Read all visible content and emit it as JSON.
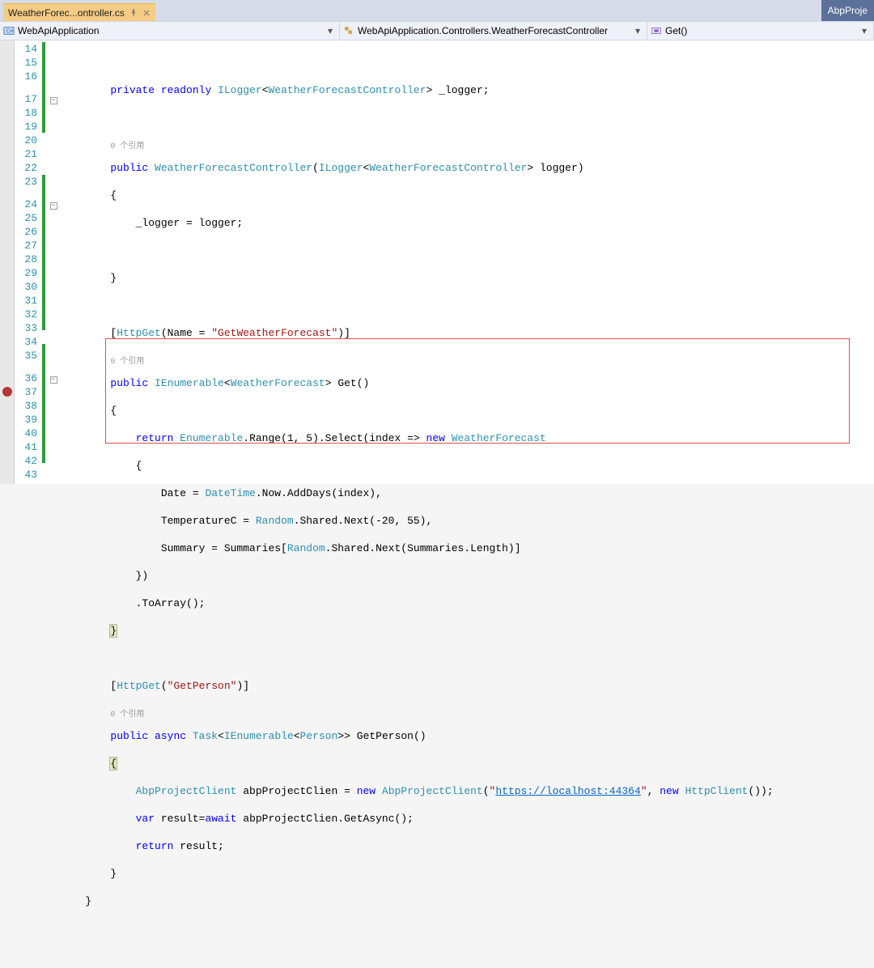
{
  "tab": {
    "title": "WeatherForec...ontroller.cs"
  },
  "rightTab": "AbpProje",
  "nav": {
    "scope1": "WebApiApplication",
    "scope2": "WebApiApplication.Controllers.WeatherForecastController",
    "scope3": "Get()"
  },
  "lines": [
    "14",
    "15",
    "16",
    "17",
    "18",
    "19",
    "20",
    "21",
    "22",
    "23",
    "24",
    "25",
    "26",
    "27",
    "28",
    "29",
    "30",
    "31",
    "32",
    "33",
    "34",
    "35",
    "36",
    "37",
    "38",
    "39",
    "40",
    "41",
    "42",
    "43"
  ],
  "refText1": "0 个引用",
  "refText2": "0 个引用",
  "refText3": "0 个引用",
  "code": {
    "l15a": "        ",
    "l15b": "private",
    "l15c": " ",
    "l15d": "readonly",
    "l15e": " ",
    "l15f": "ILogger",
    "l15g": "<",
    "l15h": "WeatherForecastController",
    "l15i": "> _logger;",
    "l17a": "        ",
    "l17b": "public",
    "l17c": " ",
    "l17d": "WeatherForecastController",
    "l17e": "(",
    "l17f": "ILogger",
    "l17g": "<",
    "l17h": "WeatherForecastController",
    "l17i": "> logger)",
    "l18": "        {",
    "l19": "            _logger = logger;",
    "l21": "        }",
    "l23a": "        [",
    "l23b": "HttpGet",
    "l23c": "(Name = ",
    "l23d": "\"GetWeatherForecast\"",
    "l23e": ")]",
    "l24a": "        ",
    "l24b": "public",
    "l24c": " ",
    "l24d": "IEnumerable",
    "l24e": "<",
    "l24f": "WeatherForecast",
    "l24g": "> ",
    "l24h": "Get",
    "l24i": "()",
    "l25": "        {",
    "l26a": "            ",
    "l26b": "return",
    "l26c": " ",
    "l26d": "Enumerable",
    "l26e": ".Range(1, 5).Select(index => ",
    "l26f": "new",
    "l26g": " ",
    "l26h": "WeatherForecast",
    "l27": "            {",
    "l28a": "                Date = ",
    "l28b": "DateTime",
    "l28c": ".Now.AddDays(index),",
    "l29a": "                TemperatureC = ",
    "l29b": "Random",
    "l29c": ".Shared.Next(-20, 55),",
    "l30a": "                Summary = Summaries[",
    "l30b": "Random",
    "l30c": ".Shared.Next(Summaries.Length)]",
    "l31": "            })",
    "l32": "            .ToArray();",
    "l33": "        }",
    "l35a": "        [",
    "l35b": "HttpGet",
    "l35c": "(",
    "l35d": "\"GetPerson\"",
    "l35e": ")]",
    "l36a": "        ",
    "l36b": "public",
    "l36c": " ",
    "l36d": "async",
    "l36e": " ",
    "l36f": "Task",
    "l36g": "<",
    "l36h": "IEnumerable",
    "l36i": "<",
    "l36j": "Person",
    "l36k": ">> ",
    "l36l": "GetPerson",
    "l36m": "()",
    "l37": "        {",
    "l38a": "            ",
    "l38b": "AbpProjectClient",
    "l38c": " abpProjectClien = ",
    "l38d": "new",
    "l38e": " ",
    "l38f": "AbpProjectClient",
    "l38g": "(",
    "l38h": "\"",
    "l38i": "https://localhost:44364",
    "l38j": "\"",
    "l38k": ", ",
    "l38l": "new",
    "l38m": " ",
    "l38n": "HttpClient",
    "l38o": "());",
    "l39a": "            ",
    "l39b": "var",
    "l39c": " result=",
    "l39d": "await",
    "l39e": " abpProjectClien.GetAsync();",
    "l40a": "            ",
    "l40b": "return",
    "l40c": " result;",
    "l41": "        }",
    "l42": "    }"
  }
}
